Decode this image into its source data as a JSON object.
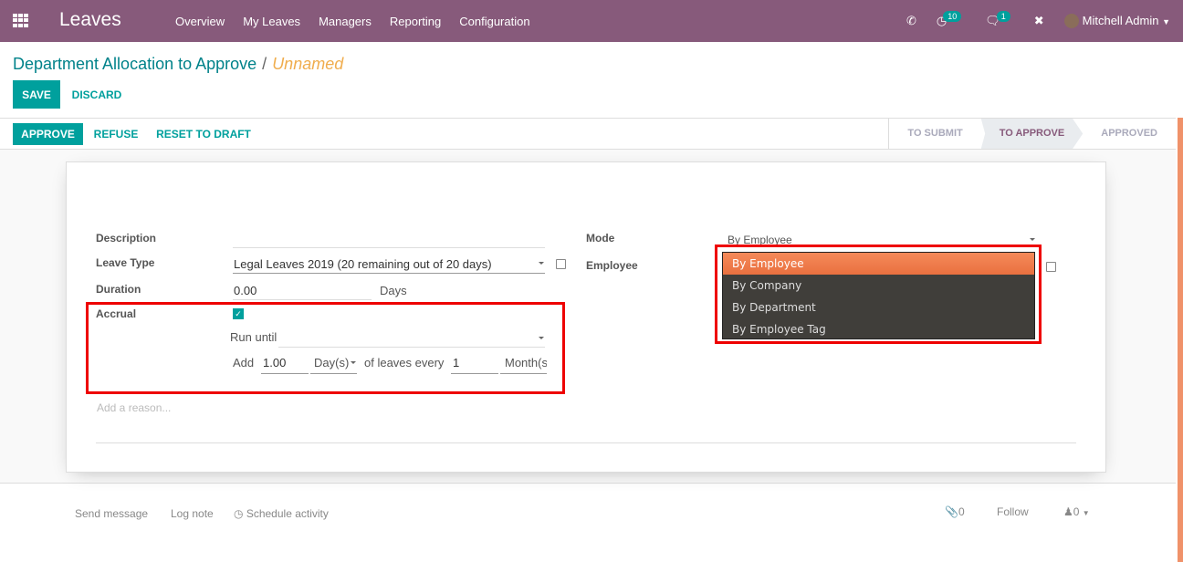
{
  "navbar": {
    "app_name": "Leaves",
    "menu": [
      "Overview",
      "My Leaves",
      "Managers",
      "Reporting",
      "Configuration"
    ],
    "activity_count": "10",
    "message_count": "1",
    "user": "Mitchell Admin"
  },
  "breadcrumb": {
    "parent": "Department Allocation to Approve",
    "current": "Unnamed"
  },
  "control": {
    "save": "SAVE",
    "discard": "DISCARD"
  },
  "header_buttons": {
    "approve": "APPROVE",
    "refuse": "REFUSE",
    "reset": "RESET TO DRAFT"
  },
  "stages": [
    {
      "label": "TO SUBMIT",
      "current": false
    },
    {
      "label": "TO APPROVE",
      "current": true
    },
    {
      "label": "APPROVED",
      "current": false
    }
  ],
  "form": {
    "description_label": "Description",
    "description_value": "",
    "leave_type_label": "Leave Type",
    "leave_type_value": "Legal Leaves 2019 (20 remaining out of 20 days)",
    "duration_label": "Duration",
    "duration_value": "0.00",
    "duration_unit": "Days",
    "accrual_label": "Accrual",
    "accrual_checked": true,
    "run_until_label": "Run until",
    "run_until_value": "",
    "add_label": "Add",
    "add_value": "1.00",
    "add_unit": "Day(s)",
    "every_label": "of leaves every",
    "every_value": "1",
    "every_unit": "Month(s)",
    "reason_placeholder": "Add a reason...",
    "mode_label": "Mode",
    "mode_value": "By Employee",
    "employee_label": "Employee",
    "mode_options": [
      "By Employee",
      "By Company",
      "By Department",
      "By Employee Tag"
    ],
    "mode_selected": "By Employee"
  },
  "chatter": {
    "send_message": "Send message",
    "log_note": "Log note",
    "schedule_activity": "Schedule activity",
    "attachments": "0",
    "follow": "Follow",
    "followers": "0"
  },
  "colors": {
    "navbar": "#875A7B",
    "primary": "#00A09D",
    "highlight": "#e00000",
    "dropdown_selected": "#f0804e"
  }
}
